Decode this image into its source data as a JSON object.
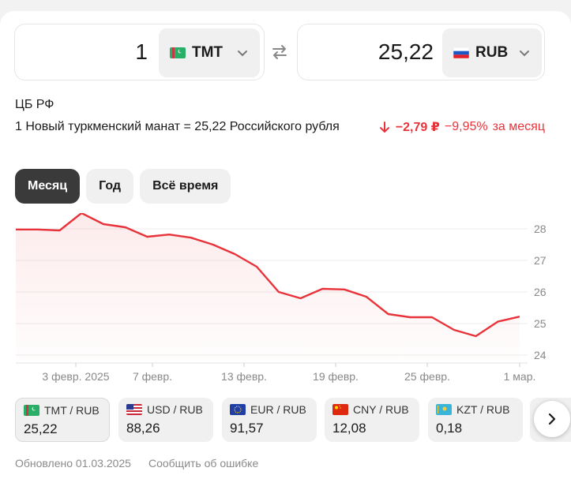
{
  "converter": {
    "from": {
      "amount": "1",
      "code": "TMT",
      "flag_icon": "turkmenistan-flag-icon"
    },
    "to": {
      "amount": "25,22",
      "code": "RUB",
      "flag_icon": "russia-flag-icon"
    }
  },
  "source": "ЦБ РФ",
  "rate_text": "1 Новый туркменский манат = 25,22 Российского рубля",
  "change": {
    "abs": "−2,79 ₽",
    "pct": "−9,95%",
    "period": "за месяц",
    "color": "#e8333a"
  },
  "periods": [
    {
      "label": "Месяц",
      "active": true
    },
    {
      "label": "Год",
      "active": false
    },
    {
      "label": "Всё время",
      "active": false
    }
  ],
  "chart_data": {
    "type": "area",
    "x": [
      "01.02.2025",
      "02.02.2025",
      "03.02.2025",
      "04.02.2025",
      "05.02.2025",
      "06.02.2025",
      "07.02.2025",
      "08.02.2025",
      "09.02.2025",
      "10.02.2025",
      "11.02.2025",
      "12.02.2025",
      "13.02.2025",
      "14.02.2025",
      "15.02.2025",
      "16.02.2025",
      "17.02.2025",
      "18.02.2025",
      "19.02.2025",
      "20.02.2025",
      "21.02.2025",
      "22.02.2025",
      "23.02.2025",
      "24.02.2025",
      "25.02.2025",
      "26.02.2025",
      "27.02.2025",
      "28.02.2025",
      "01.03.2025"
    ],
    "y": [
      27.98,
      27.98,
      27.95,
      28.5,
      28.15,
      28.05,
      27.75,
      27.82,
      27.72,
      27.5,
      27.2,
      26.8,
      26.0,
      25.8,
      26.1,
      26.08,
      25.85,
      25.3,
      25.2,
      25.2,
      24.8,
      24.6,
      25.06,
      25.22
    ],
    "x_sampled": [
      "01.02",
      "02.02",
      "03.02",
      "04.02",
      "05.02",
      "06.02",
      "07.02",
      "08.02",
      "09.02",
      "10.02",
      "11.02",
      "12.02",
      "13.02",
      "15.02",
      "16.02",
      "18.02",
      "19.02",
      "21.02",
      "22.02",
      "25.02",
      "26.02",
      "28.02",
      "28.02b",
      "01.03"
    ],
    "x_tick_labels": [
      "3 февр. 2025",
      "7 февр.",
      "13 февр.",
      "19 февр.",
      "25 февр.",
      "1 мар."
    ],
    "y_tick_labels": [
      "28",
      "27",
      "26",
      "25",
      "24"
    ],
    "ylim": [
      23.8,
      28.5
    ],
    "grid": true,
    "line_color": "#e8333a"
  },
  "pairs": [
    {
      "label": "TMT / RUB",
      "value": "25,22",
      "flag_icon": "turkmenistan-flag-icon",
      "active": true
    },
    {
      "label": "USD / RUB",
      "value": "88,26",
      "flag_icon": "usa-flag-icon",
      "active": false
    },
    {
      "label": "EUR / RUB",
      "value": "91,57",
      "flag_icon": "eu-flag-icon",
      "active": false
    },
    {
      "label": "CNY / RUB",
      "value": "12,08",
      "flag_icon": "china-flag-icon",
      "active": false
    },
    {
      "label": "KZT / RUB",
      "value": "0,18",
      "flag_icon": "kazakhstan-flag-icon",
      "active": false
    }
  ],
  "footer": {
    "updated": "Обновлено 01.03.2025",
    "report": "Сообщить об ошибке"
  }
}
